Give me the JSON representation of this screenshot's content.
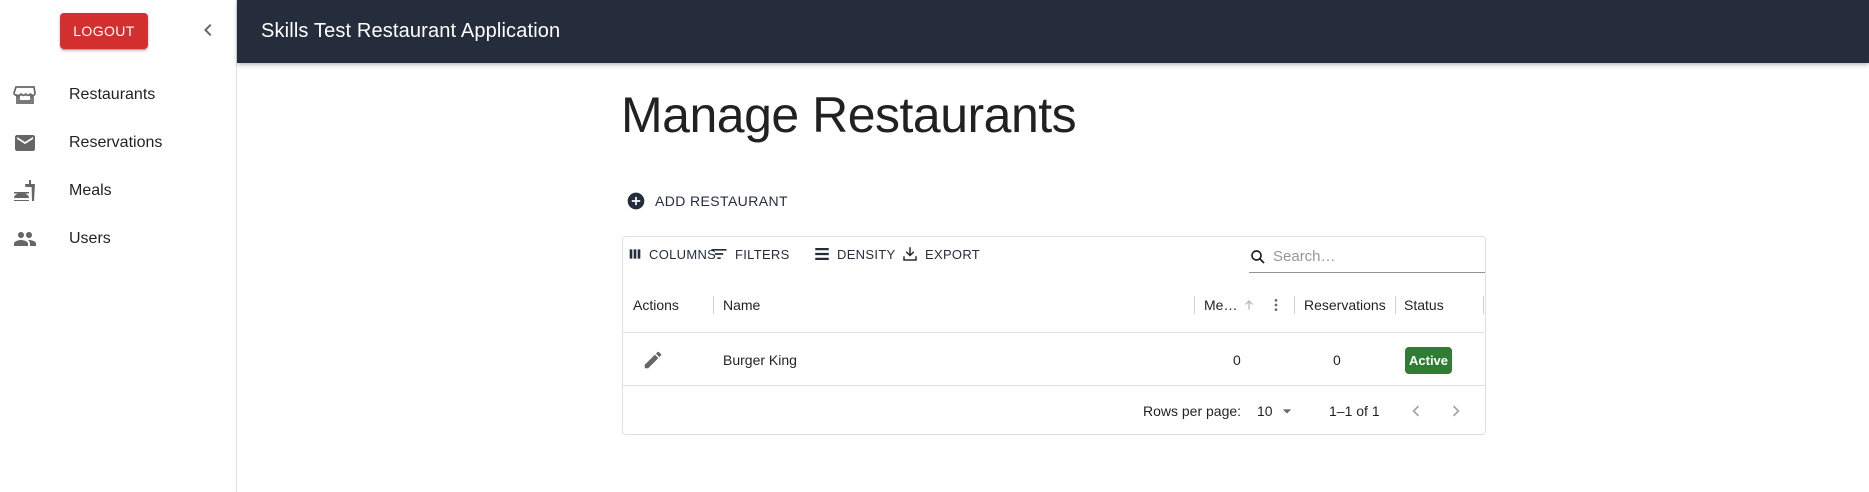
{
  "sidebar": {
    "logout_label": "LOGOUT",
    "items": [
      {
        "label": "Restaurants",
        "icon": "store-icon"
      },
      {
        "label": "Reservations",
        "icon": "mail-icon"
      },
      {
        "label": "Meals",
        "icon": "fastfood-icon"
      },
      {
        "label": "Users",
        "icon": "people-icon"
      }
    ]
  },
  "appbar": {
    "title": "Skills Test Restaurant Application"
  },
  "main": {
    "page_title": "Manage Restaurants",
    "add_button_label": "ADD RESTAURANT"
  },
  "grid": {
    "toolbar": {
      "columns": "COLUMNS",
      "filters": "FILTERS",
      "density": "DENSITY",
      "export": "EXPORT",
      "search_placeholder": "Search…"
    },
    "columns": [
      "Actions",
      "Name",
      "Me…",
      "Reservations",
      "Status"
    ],
    "rows": [
      {
        "name": "Burger King",
        "meals": "0",
        "reservations": "0",
        "status": "Active"
      }
    ],
    "footer": {
      "rows_per_page_label": "Rows per page:",
      "rows_per_page_value": "10",
      "range": "1–1 of 1"
    }
  },
  "colors": {
    "appbar": "#252d3d",
    "logout": "#d32f2f",
    "status_active": "#2e7d32"
  }
}
